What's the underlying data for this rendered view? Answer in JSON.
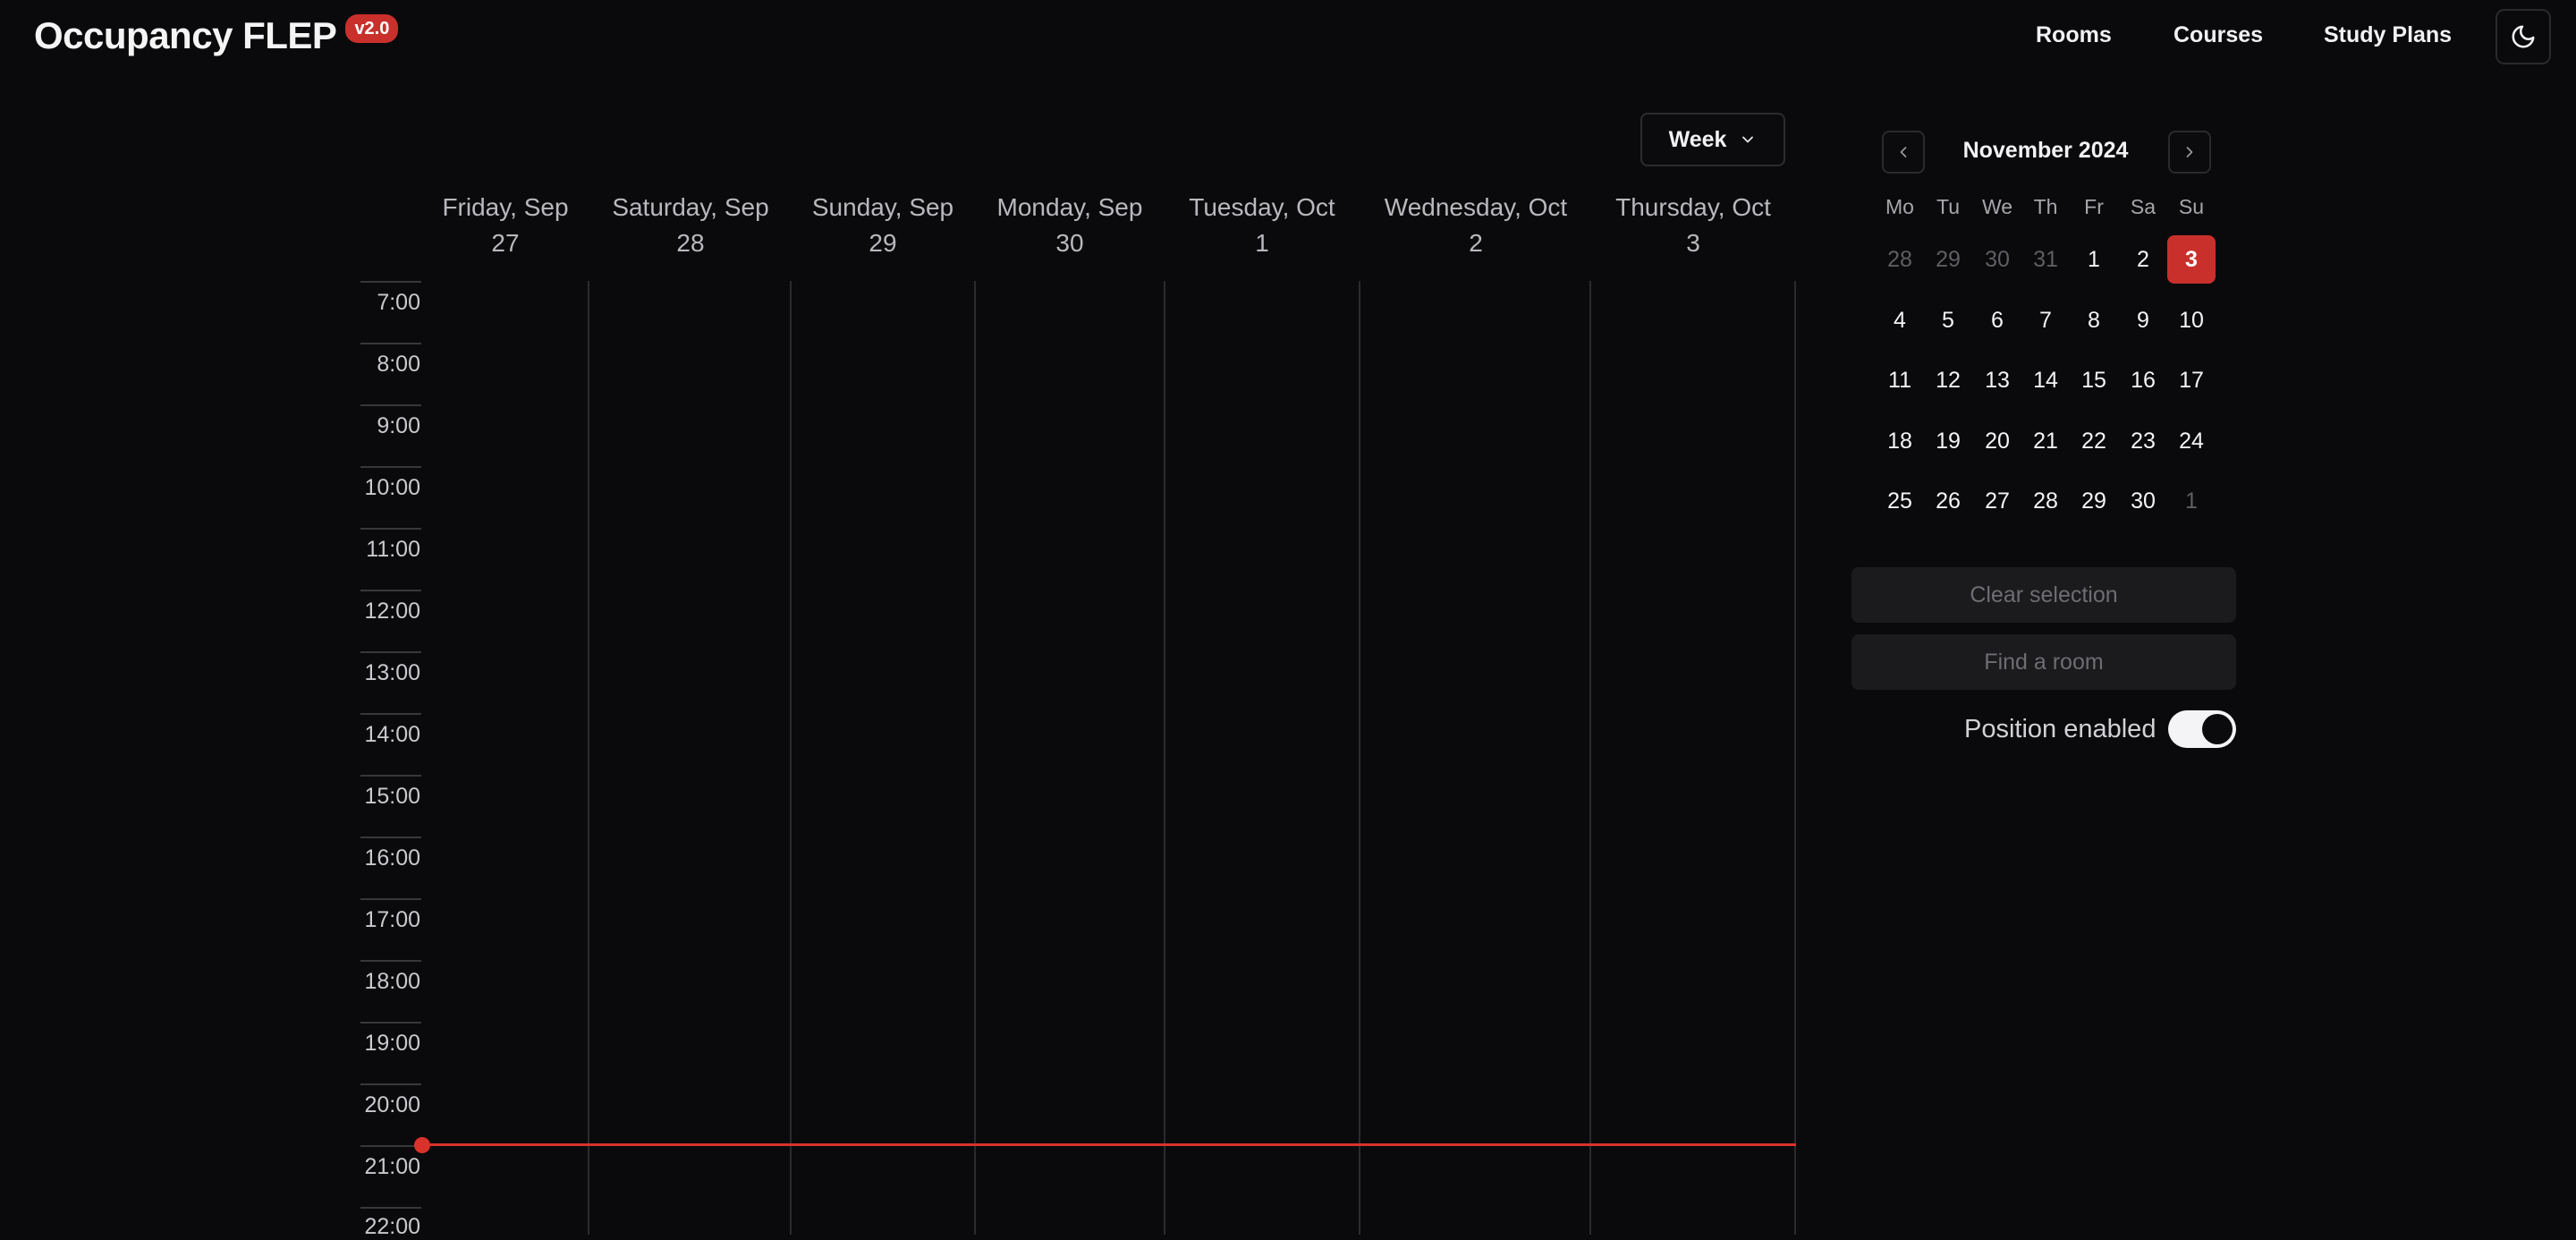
{
  "app": {
    "title": "Occupancy FLEP",
    "version": "v2.0"
  },
  "nav": {
    "items": [
      "Rooms",
      "Courses",
      "Study Plans"
    ],
    "theme_icon": "moon-icon"
  },
  "view_select": {
    "label": "Week",
    "icon": "chevron-down-icon"
  },
  "days": [
    {
      "line1": "Friday, Sep",
      "line2": "27"
    },
    {
      "line1": "Saturday, Sep",
      "line2": "28"
    },
    {
      "line1": "Sunday, Sep",
      "line2": "29"
    },
    {
      "line1": "Monday, Sep",
      "line2": "30"
    },
    {
      "line1": "Tuesday, Oct",
      "line2": "1"
    },
    {
      "line1": "Wednesday, Oct",
      "line2": "2"
    },
    {
      "line1": "Thursday, Oct",
      "line2": "3"
    }
  ],
  "hours": [
    "7:00",
    "8:00",
    "9:00",
    "10:00",
    "11:00",
    "12:00",
    "13:00",
    "14:00",
    "15:00",
    "16:00",
    "17:00",
    "18:00",
    "19:00",
    "20:00",
    "21:00",
    "22:00"
  ],
  "current_time_color": "#d9322b",
  "mini_calendar": {
    "title": "November 2024",
    "prev_icon": "chevron-left-icon",
    "next_icon": "chevron-right-icon",
    "weekdays": [
      "Mo",
      "Tu",
      "We",
      "Th",
      "Fr",
      "Sa",
      "Su"
    ],
    "weeks": [
      [
        {
          "d": "28",
          "muted": true
        },
        {
          "d": "29",
          "muted": true
        },
        {
          "d": "30",
          "muted": true
        },
        {
          "d": "31",
          "muted": true
        },
        {
          "d": "1"
        },
        {
          "d": "2"
        },
        {
          "d": "3",
          "selected": true
        }
      ],
      [
        {
          "d": "4"
        },
        {
          "d": "5"
        },
        {
          "d": "6"
        },
        {
          "d": "7"
        },
        {
          "d": "8"
        },
        {
          "d": "9"
        },
        {
          "d": "10"
        }
      ],
      [
        {
          "d": "11"
        },
        {
          "d": "12"
        },
        {
          "d": "13"
        },
        {
          "d": "14"
        },
        {
          "d": "15"
        },
        {
          "d": "16"
        },
        {
          "d": "17"
        }
      ],
      [
        {
          "d": "18"
        },
        {
          "d": "19"
        },
        {
          "d": "20"
        },
        {
          "d": "21"
        },
        {
          "d": "22"
        },
        {
          "d": "23"
        },
        {
          "d": "24"
        }
      ],
      [
        {
          "d": "25"
        },
        {
          "d": "26"
        },
        {
          "d": "27"
        },
        {
          "d": "28"
        },
        {
          "d": "29"
        },
        {
          "d": "30"
        },
        {
          "d": "1",
          "muted": true
        }
      ]
    ],
    "selected_color": "#c9302c"
  },
  "actions": {
    "clear_selection": "Clear selection",
    "find_room": "Find a room"
  },
  "position": {
    "label": "Position enabled",
    "enabled": true
  }
}
